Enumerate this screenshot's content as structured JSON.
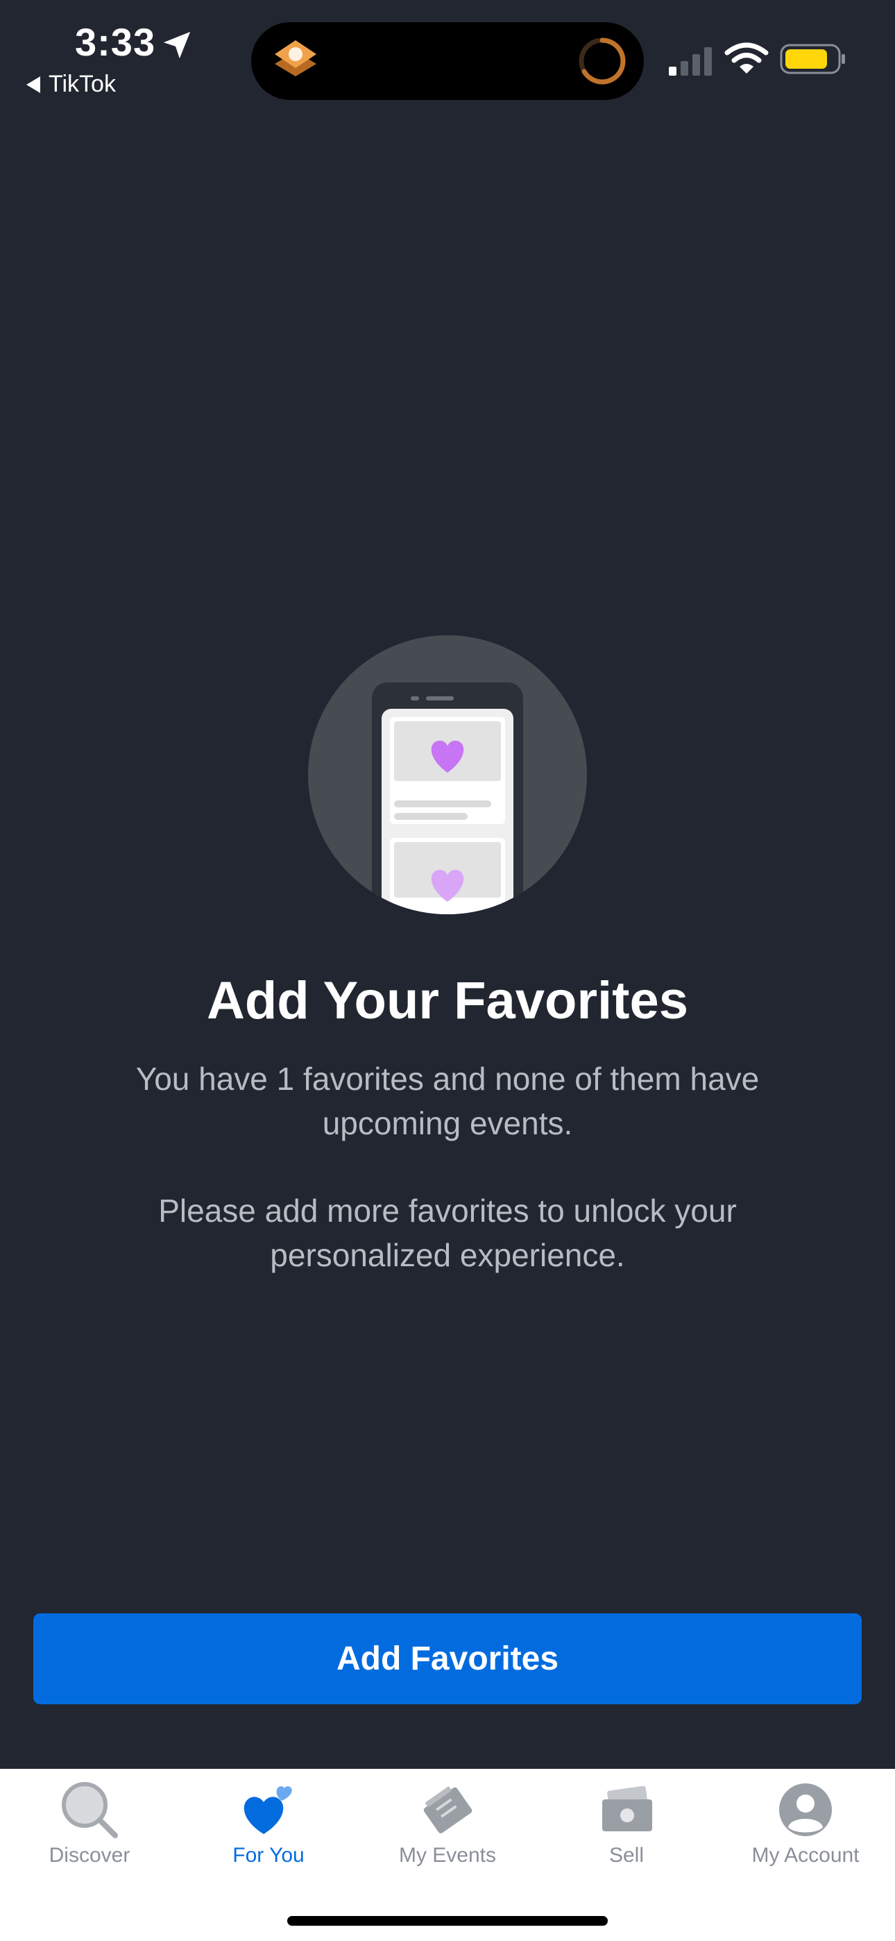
{
  "status": {
    "time": "3:33",
    "back_app": "TikTok"
  },
  "content": {
    "title": "Add Your Favorites",
    "message": "You have 1 favorites and none of them have upcoming events.",
    "prompt": "Please add more favorites to unlock your personalized experience.",
    "primary_button": "Add Favorites"
  },
  "tabs": [
    {
      "label": "Discover",
      "icon": "search-icon",
      "active": false
    },
    {
      "label": "For You",
      "icon": "heart-icon",
      "active": true
    },
    {
      "label": "My Events",
      "icon": "ticket-icon",
      "active": false
    },
    {
      "label": "Sell",
      "icon": "money-icon",
      "active": false
    },
    {
      "label": "My Account",
      "icon": "user-icon",
      "active": false
    }
  ],
  "colors": {
    "background": "#212630",
    "accent": "#026cdf",
    "heart": "#c774f5",
    "tab_inactive": "#8a8f98"
  }
}
